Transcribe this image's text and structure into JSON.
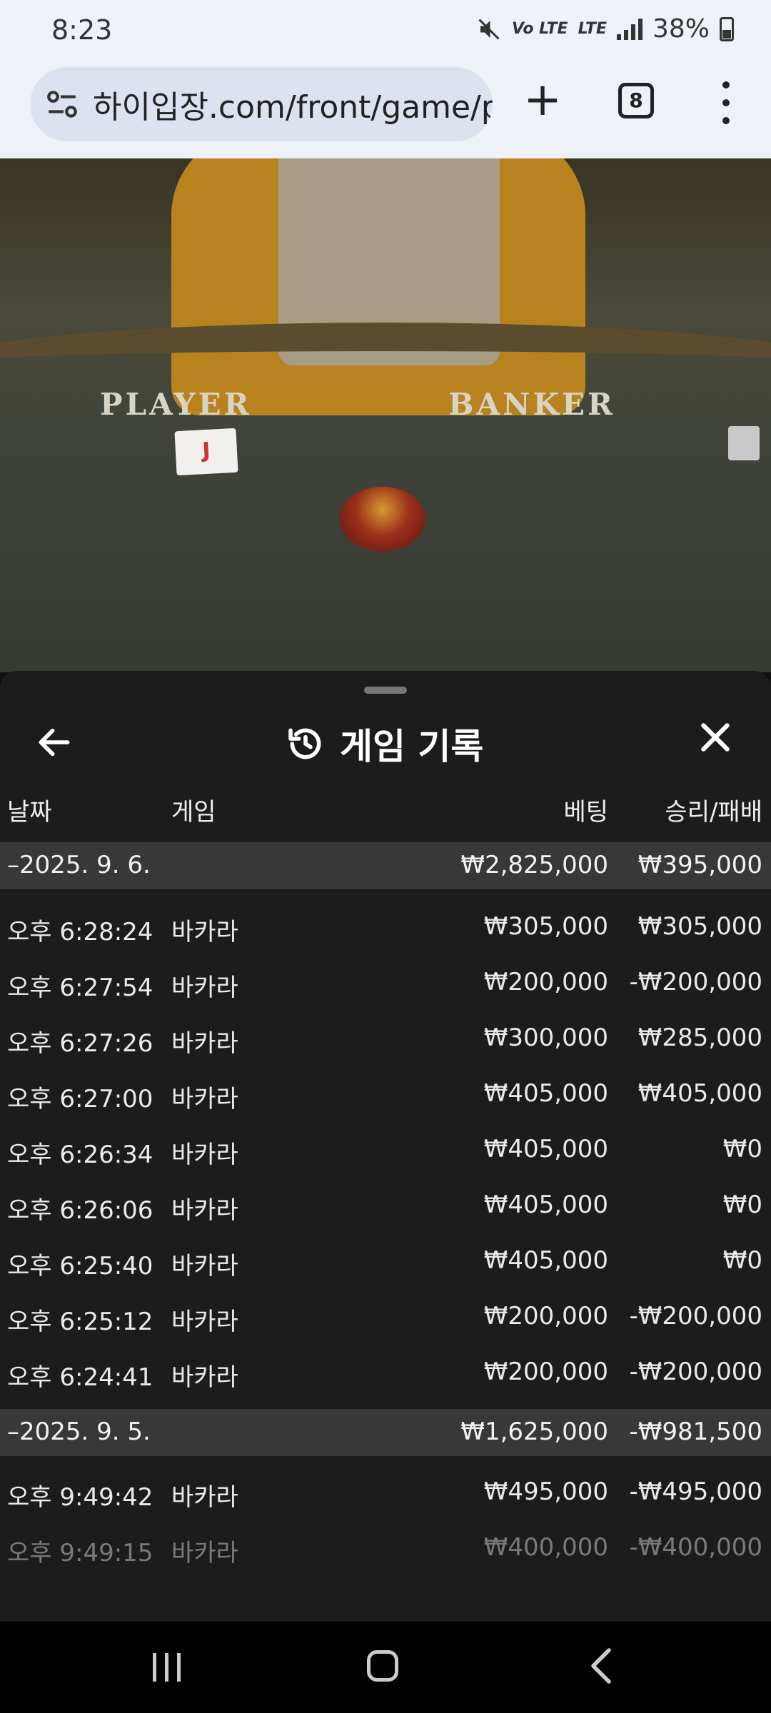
{
  "status": {
    "time": "8:23",
    "network": "Vo LTE",
    "lte": "LTE",
    "battery": "38%"
  },
  "browser": {
    "url": "하이입장.com/front/game/play",
    "tab_count": "8"
  },
  "video": {
    "player_label": "PLAYER",
    "banker_label": "BANKER",
    "card": "J"
  },
  "sheet": {
    "title": "게임 기록",
    "columns": {
      "date": "날짜",
      "game": "게임",
      "bet": "베팅",
      "winloss": "승리/패배"
    },
    "groups": [
      {
        "date": "–2025. 9. 6.",
        "bet": "₩2,825,000",
        "winloss": "₩395,000",
        "rows": [
          {
            "time": "오후 6:28:24",
            "game": "바카라",
            "bet": "₩305,000",
            "winloss": "₩305,000"
          },
          {
            "time": "오후 6:27:54",
            "game": "바카라",
            "bet": "₩200,000",
            "winloss": "-₩200,000"
          },
          {
            "time": "오후 6:27:26",
            "game": "바카라",
            "bet": "₩300,000",
            "winloss": "₩285,000"
          },
          {
            "time": "오후 6:27:00",
            "game": "바카라",
            "bet": "₩405,000",
            "winloss": "₩405,000"
          },
          {
            "time": "오후 6:26:34",
            "game": "바카라",
            "bet": "₩405,000",
            "winloss": "₩0"
          },
          {
            "time": "오후 6:26:06",
            "game": "바카라",
            "bet": "₩405,000",
            "winloss": "₩0"
          },
          {
            "time": "오후 6:25:40",
            "game": "바카라",
            "bet": "₩405,000",
            "winloss": "₩0"
          },
          {
            "time": "오후 6:25:12",
            "game": "바카라",
            "bet": "₩200,000",
            "winloss": "-₩200,000"
          },
          {
            "time": "오후 6:24:41",
            "game": "바카라",
            "bet": "₩200,000",
            "winloss": "-₩200,000"
          }
        ]
      },
      {
        "date": "–2025. 9. 5.",
        "bet": "₩1,625,000",
        "winloss": "-₩981,500",
        "rows": [
          {
            "time": "오후 9:49:42",
            "game": "바카라",
            "bet": "₩495,000",
            "winloss": "-₩495,000"
          },
          {
            "time": "오후 9:49:15",
            "game": "바카라",
            "bet": "₩400,000",
            "winloss": "-₩400,000"
          }
        ]
      }
    ]
  },
  "icons": {
    "back": "arrow-left-icon",
    "history": "history-icon",
    "close": "close-icon"
  }
}
